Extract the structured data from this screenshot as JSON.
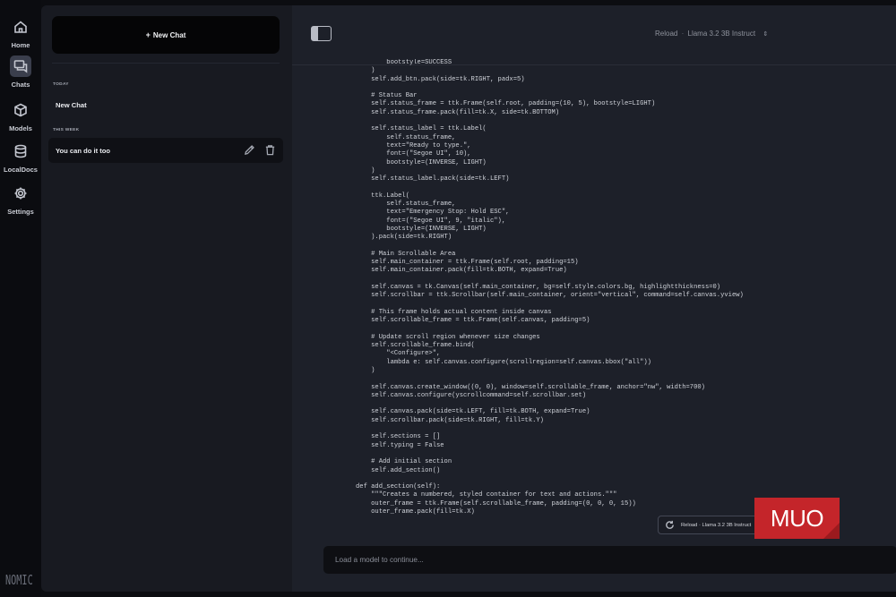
{
  "rail": {
    "items": [
      {
        "label": "Home",
        "icon": "home-icon"
      },
      {
        "label": "Chats",
        "icon": "chat-icon"
      },
      {
        "label": "Models",
        "icon": "cube-icon"
      },
      {
        "label": "LocalDocs",
        "icon": "database-icon"
      },
      {
        "label": "Settings",
        "icon": "gear-icon"
      }
    ],
    "brand": "NOMIC"
  },
  "sidebar": {
    "new_chat_label": "New Chat",
    "sections": [
      {
        "label": "TODAY",
        "chats": [
          "New Chat"
        ]
      },
      {
        "label": "THIS WEEK",
        "chats": [
          "You can do it too"
        ]
      }
    ]
  },
  "header": {
    "reload_label": "Reload",
    "separator": "·",
    "model_name": "Llama 3.2 3B Instruct"
  },
  "code_lines": [
    "        bootstyle=SUCCESS",
    "    )",
    "    self.add_btn.pack(side=tk.RIGHT, padx=5)",
    "",
    "    # Status Bar",
    "    self.status_frame = ttk.Frame(self.root, padding=(10, 5), bootstyle=LIGHT)",
    "    self.status_frame.pack(fill=tk.X, side=tk.BOTTOM)",
    "",
    "    self.status_label = ttk.Label(",
    "        self.status_frame,",
    "        text=\"Ready to type.\",",
    "        font=(\"Segoe UI\", 10),",
    "        bootstyle=(INVERSE, LIGHT)",
    "    )",
    "    self.status_label.pack(side=tk.LEFT)",
    "",
    "    ttk.Label(",
    "        self.status_frame,",
    "        text=\"Emergency Stop: Hold ESC\",",
    "        font=(\"Segoe UI\", 9, \"italic\"),",
    "        bootstyle=(INVERSE, LIGHT)",
    "    ).pack(side=tk.RIGHT)",
    "",
    "    # Main Scrollable Area",
    "    self.main_container = ttk.Frame(self.root, padding=15)",
    "    self.main_container.pack(fill=tk.BOTH, expand=True)",
    "",
    "    self.canvas = tk.Canvas(self.main_container, bg=self.style.colors.bg, highlightthickness=0)",
    "    self.scrollbar = ttk.Scrollbar(self.main_container, orient=\"vertical\", command=self.canvas.yview)",
    "",
    "    # This frame holds actual content inside canvas",
    "    self.scrollable_frame = ttk.Frame(self.canvas, padding=5)",
    "",
    "    # Update scroll region whenever size changes",
    "    self.scrollable_frame.bind(",
    "        \"<Configure>\",",
    "        lambda e: self.canvas.configure(scrollregion=self.canvas.bbox(\"all\"))",
    "    )",
    "",
    "    self.canvas.create_window((0, 0), window=self.scrollable_frame, anchor=\"nw\", width=700)",
    "    self.canvas.configure(yscrollcommand=self.scrollbar.set)",
    "",
    "    self.canvas.pack(side=tk.LEFT, fill=tk.BOTH, expand=True)",
    "    self.scrollbar.pack(side=tk.RIGHT, fill=tk.Y)",
    "",
    "    self.sections = []",
    "    self.typing = False",
    "",
    "    # Add initial section",
    "    self.add_section()",
    "",
    "def add_section(self):",
    "    \"\"\"Creates a numbered, styled container for text and actions.\"\"\"",
    "    outer_frame = ttk.Frame(self.scrollable_frame, padding=(0, 0, 0, 15))",
    "    outer_frame.pack(fill=tk.X)"
  ],
  "floating_reload": {
    "label": "Reload · Llama 3.2 3B Instruct",
    "icon": "reload-icon"
  },
  "watermark": "MUO",
  "prompt": {
    "placeholder": "Load a model to continue..."
  },
  "colors": {
    "accent": "#c4252a",
    "sidebar_bg": "#181a21",
    "main_bg": "#1d2029"
  }
}
